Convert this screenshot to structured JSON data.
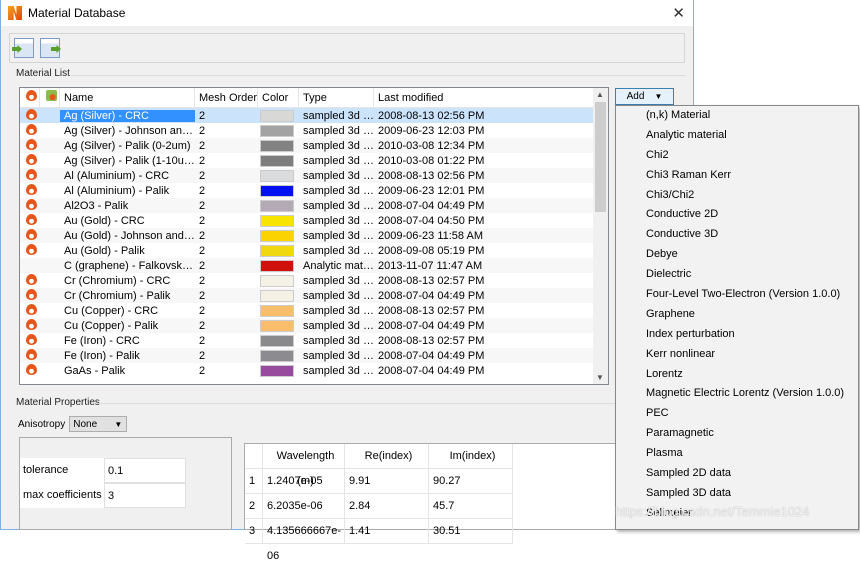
{
  "window": {
    "title": "Material Database",
    "close": "✕"
  },
  "material_list": {
    "label": "Material List",
    "columns": [
      "",
      "",
      "Name",
      "Mesh Order",
      "Color",
      "Type",
      "Last modified"
    ],
    "rows": [
      {
        "name": "Ag (Silver) - CRC",
        "mesh": "2",
        "color": "#d8d8d6",
        "type": "sampled 3d d...",
        "modified": "2008-08-13 02:56 PM",
        "selected": true
      },
      {
        "name": "Ag (Silver) - Johnson and C...",
        "mesh": "2",
        "color": "#a3a3a3",
        "type": "sampled 3d d...",
        "modified": "2009-06-23 12:03 PM"
      },
      {
        "name": "Ag (Silver) - Palik (0-2um)",
        "mesh": "2",
        "color": "#828282",
        "type": "sampled 3d d...",
        "modified": "2010-03-08 12:34 PM"
      },
      {
        "name": "Ag (Silver) - Palik (1-10um)",
        "mesh": "2",
        "color": "#7d7d7d",
        "type": "sampled 3d d...",
        "modified": "2010-03-08 01:22 PM"
      },
      {
        "name": "Al (Aluminium) - CRC",
        "mesh": "2",
        "color": "#d9dbdc",
        "type": "sampled 3d d...",
        "modified": "2008-08-13 02:56 PM"
      },
      {
        "name": "Al (Aluminium) - Palik",
        "mesh": "2",
        "color": "#0010f0",
        "type": "sampled 3d d...",
        "modified": "2009-06-23 12:01 PM"
      },
      {
        "name": "Al2O3 - Palik",
        "mesh": "2",
        "color": "#b3aab6",
        "type": "sampled 3d d...",
        "modified": "2008-07-04 04:49 PM"
      },
      {
        "name": "Au (Gold) - CRC",
        "mesh": "2",
        "color": "#f7e400",
        "type": "sampled 3d d...",
        "modified": "2008-07-04 04:50 PM"
      },
      {
        "name": "Au (Gold) - Johnson and C...",
        "mesh": "2",
        "color": "#fbd400",
        "type": "sampled 3d d...",
        "modified": "2009-06-23 11:58 AM"
      },
      {
        "name": "Au (Gold) - Palik",
        "mesh": "2",
        "color": "#f0d810",
        "type": "sampled 3d d...",
        "modified": "2008-09-08 05:19 PM"
      },
      {
        "name": "C (graphene) - Falkovsky (...",
        "mesh": "2",
        "color": "#d0100a",
        "type": "Analytic mate...",
        "modified": "2013-11-07 11:47 AM",
        "noicon": true
      },
      {
        "name": "Cr (Chromium) - CRC",
        "mesh": "2",
        "color": "#f4f1e6",
        "type": "sampled 3d d...",
        "modified": "2008-08-13 02:57 PM"
      },
      {
        "name": "Cr (Chromium) - Palik",
        "mesh": "2",
        "color": "#f5f0e6",
        "type": "sampled 3d d...",
        "modified": "2008-07-04 04:49 PM"
      },
      {
        "name": "Cu (Copper) - CRC",
        "mesh": "2",
        "color": "#f8be6c",
        "type": "sampled 3d d...",
        "modified": "2008-08-13 02:57 PM"
      },
      {
        "name": "Cu (Copper) - Palik",
        "mesh": "2",
        "color": "#f9be6c",
        "type": "sampled 3d d...",
        "modified": "2008-07-04 04:49 PM"
      },
      {
        "name": "Fe (Iron) - CRC",
        "mesh": "2",
        "color": "#8a8a8c",
        "type": "sampled 3d d...",
        "modified": "2008-08-13 02:57 PM"
      },
      {
        "name": "Fe (Iron) - Palik",
        "mesh": "2",
        "color": "#8c8c90",
        "type": "sampled 3d d...",
        "modified": "2008-07-04 04:49 PM"
      },
      {
        "name": "GaAs - Palik",
        "mesh": "2",
        "color": "#984a9c",
        "type": "sampled 3d d...",
        "modified": "2008-07-04 04:49 PM"
      }
    ]
  },
  "add_button": {
    "label": "Add",
    "arrow": "▼"
  },
  "add_menu": [
    "(n,k) Material",
    "Analytic material",
    "Chi2",
    "Chi3 Raman Kerr",
    "Chi3/Chi2",
    "Conductive 2D",
    "Conductive 3D",
    "Debye",
    "Dielectric",
    "Four-Level Two-Electron (Version 1.0.0)",
    "Graphene",
    "Index perturbation",
    "Kerr nonlinear",
    "Lorentz",
    "Magnetic Electric Lorentz (Version 1.0.0)",
    "PEC",
    "Paramagnetic",
    "Plasma",
    "Sampled 2D data",
    "Sampled 3D data",
    "Selimeier"
  ],
  "properties": {
    "label": "Material Properties",
    "anisotropy_label": "Anisotropy",
    "anisotropy_value": "None",
    "params": [
      {
        "name": "tolerance",
        "value": "0.1"
      },
      {
        "name": "max coefficients",
        "value": "3"
      }
    ],
    "data_columns": [
      "",
      "Wavelength (m)",
      "Re(index)",
      "Im(index)"
    ],
    "data_rows": [
      [
        "1",
        "1.2407e-05",
        "9.91",
        "90.27"
      ],
      [
        "2",
        "6.2035e-06",
        "2.84",
        "45.7"
      ],
      [
        "3",
        "4.135666667e-06",
        "1.41",
        "30.51"
      ]
    ]
  },
  "watermark": "https://blog.csdn.net/Temmie1024"
}
